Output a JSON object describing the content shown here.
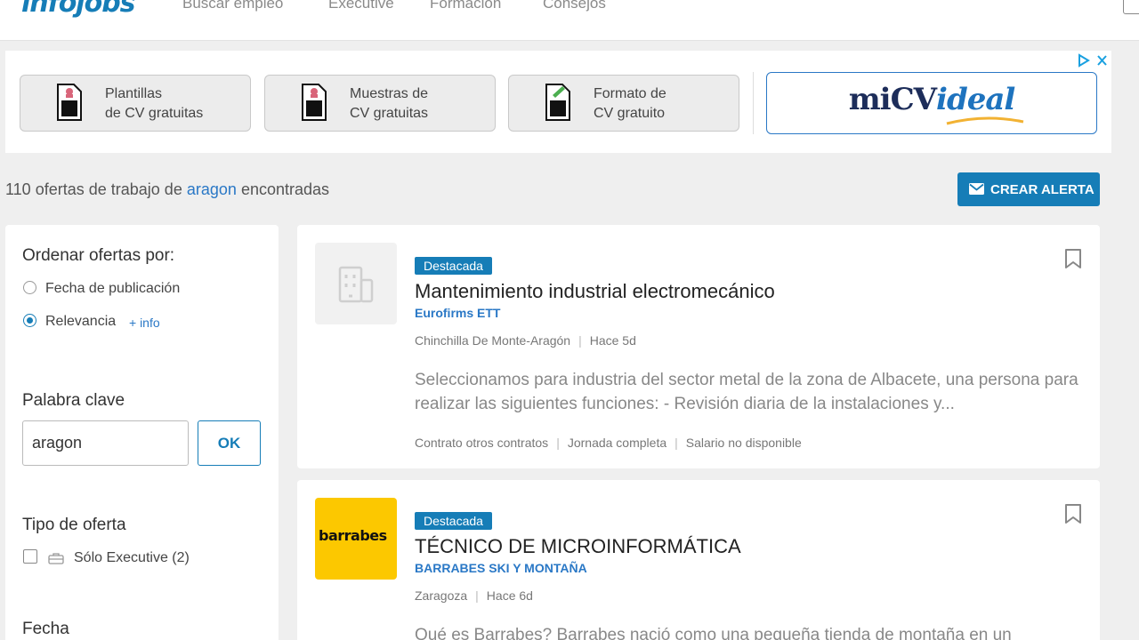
{
  "nav": {
    "logo": "infojobs",
    "links": [
      "Buscar empleo",
      "Executive",
      "Formación",
      "Consejos"
    ]
  },
  "ad": {
    "buttons": [
      {
        "label": "Plantillas\nde CV gratuitas"
      },
      {
        "label": "Muestras de\nCV gratuitas"
      },
      {
        "label": "Formato de\nCV gratuito"
      }
    ],
    "brand_a": "miCV",
    "brand_b": "ideal"
  },
  "results": {
    "count": "110",
    "prefix": "ofertas de trabajo de",
    "keyword": "aragon",
    "suffix": "encontradas"
  },
  "alert_button": "CREAR ALERTA",
  "sidebar": {
    "sort_title": "Ordenar ofertas por:",
    "sort_date": "Fecha de publicación",
    "sort_relevance": "Relevancia",
    "more_info": "+ info",
    "keyword_title": "Palabra clave",
    "keyword_value": "aragon",
    "ok_label": "OK",
    "offer_type_title": "Tipo de oferta",
    "executive_only": "Sólo Executive (2)",
    "date_title": "Fecha"
  },
  "offers": [
    {
      "badge": "Destacada",
      "title": "Mantenimiento industrial electromecánico",
      "company": "Eurofirms ETT",
      "location": "Chinchilla De Monte-Aragón",
      "posted": "Hace 5d",
      "description": "Seleccionamos para industria del sector metal de la zona de Albacete, una persona para realizar las siguientes funciones: - Revisión diaria de la instalaciones y...",
      "contract": "Contrato otros contratos",
      "schedule": "Jornada completa",
      "salary": "Salario no disponible"
    },
    {
      "badge": "Destacada",
      "title": "TÉCNICO DE MICROINFORMÁTICA",
      "company": "BARRABES SKI Y MONTAÑA",
      "location": "Zaragoza",
      "posted": "Hace 6d",
      "logo_text": "barrabes",
      "description": "Qué es Barrabes? Barrabes nació como una pequeña tienda de montaña en un"
    }
  ],
  "colors": {
    "primary": "#167db7",
    "link": "#2a78c6",
    "barrabes_yellow": "#fcc800"
  }
}
